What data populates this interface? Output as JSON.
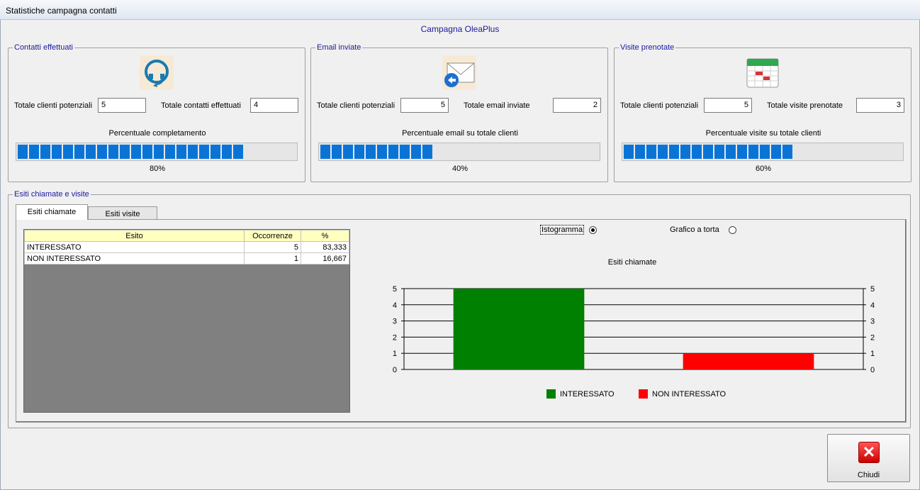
{
  "window": {
    "title": "Statistiche campagna contatti"
  },
  "campaign_title": "Campagna OleaPlus",
  "panels": [
    {
      "legend": "Contatti effettuati",
      "icon": "headset-icon",
      "label1": "Totale clienti potenziali",
      "value1": "5",
      "label2": "Totale contatti effettuati",
      "value2": "4",
      "progress_label": "Percentuale completamento",
      "percent": 80,
      "percent_text": "80%"
    },
    {
      "legend": "Email inviate",
      "icon": "email-reply-icon",
      "label1": "Totale clienti potenziali",
      "value1": "5",
      "label2": "Totale email inviate",
      "value2": "2",
      "progress_label": "Percentuale email su totale clienti",
      "percent": 40,
      "percent_text": "40%"
    },
    {
      "legend": "Visite prenotate",
      "icon": "calendar-icon",
      "label1": "Totale clienti potenziali",
      "value1": "5",
      "label2": "Totale visite prenotate",
      "value2": "3",
      "progress_label": "Percentuale visite su totale clienti",
      "percent": 60,
      "percent_text": "60%"
    }
  ],
  "results": {
    "legend": "Esiti chiamate e visite",
    "tabs": [
      {
        "label": "Esiti chiamate",
        "active": true
      },
      {
        "label": "Esiti visite",
        "active": false
      }
    ],
    "table": {
      "headers": [
        "Esito",
        "Occorrenze",
        "%"
      ],
      "rows": [
        [
          "INTERESSATO",
          "5",
          "83,333"
        ],
        [
          "NON INTERESSATO",
          "1",
          "16,667"
        ]
      ]
    },
    "radio_histogram": "Istogramma",
    "radio_pie": "Grafico a torta",
    "selected_view": "Istogramma"
  },
  "chart_data": {
    "type": "bar",
    "title": "Esiti chiamate",
    "categories": [
      "INTERESSATO",
      "NON INTERESSATO"
    ],
    "values": [
      5,
      1
    ],
    "colors": [
      "#008000",
      "#ff0000"
    ],
    "ylim": [
      0,
      5
    ],
    "yticks": [
      0,
      1,
      2,
      3,
      4,
      5
    ],
    "grid": true,
    "legend_position": "bottom"
  },
  "close_button": {
    "label": "Chiudi",
    "icon": "close-icon"
  }
}
